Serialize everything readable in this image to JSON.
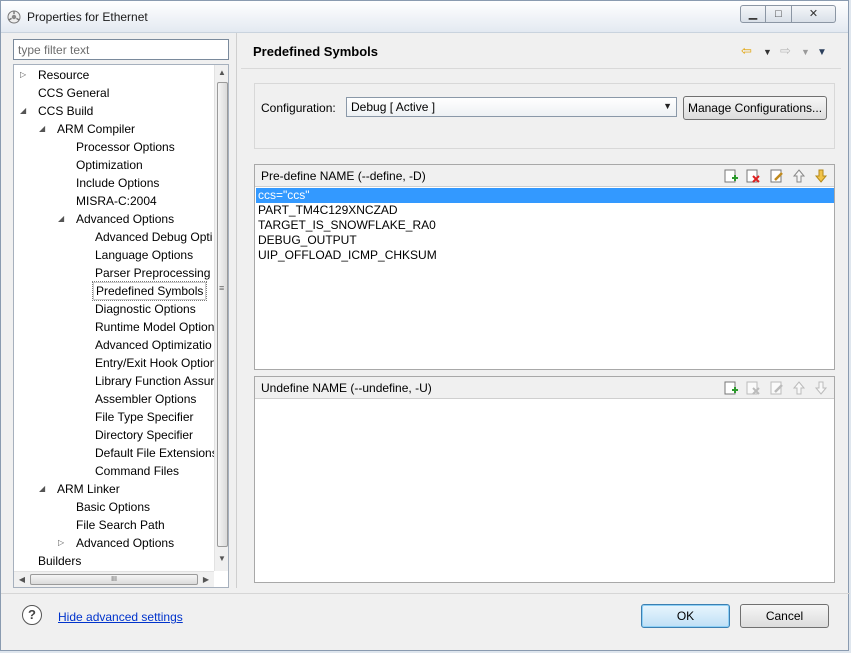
{
  "window": {
    "title": "Properties for Ethernet",
    "controls": {
      "minimize": "▁",
      "maximize": "□",
      "close": "✕"
    }
  },
  "filter": {
    "placeholder": "type filter text"
  },
  "tree": {
    "selected": "Predefined Symbols",
    "items": [
      {
        "label": "Resource",
        "level": 0,
        "expander": "collapsed"
      },
      {
        "label": "CCS General",
        "level": 0,
        "expander": "none"
      },
      {
        "label": "CCS Build",
        "level": 0,
        "expander": "expanded"
      },
      {
        "label": "ARM Compiler",
        "level": 1,
        "expander": "expanded"
      },
      {
        "label": "Processor Options",
        "level": 2,
        "expander": "none"
      },
      {
        "label": "Optimization",
        "level": 2,
        "expander": "none"
      },
      {
        "label": "Include Options",
        "level": 2,
        "expander": "none"
      },
      {
        "label": "MISRA-C:2004",
        "level": 2,
        "expander": "none"
      },
      {
        "label": "Advanced Options",
        "level": 2,
        "expander": "expanded"
      },
      {
        "label": "Advanced Debug Opti",
        "level": 3,
        "expander": "none"
      },
      {
        "label": "Language Options",
        "level": 3,
        "expander": "none"
      },
      {
        "label": "Parser Preprocessing C",
        "level": 3,
        "expander": "none"
      },
      {
        "label": "Predefined Symbols",
        "level": 3,
        "expander": "none"
      },
      {
        "label": "Diagnostic Options",
        "level": 3,
        "expander": "none"
      },
      {
        "label": "Runtime Model Option",
        "level": 3,
        "expander": "none"
      },
      {
        "label": "Advanced Optimizatio",
        "level": 3,
        "expander": "none"
      },
      {
        "label": "Entry/Exit Hook Option",
        "level": 3,
        "expander": "none"
      },
      {
        "label": "Library Function Assur",
        "level": 3,
        "expander": "none"
      },
      {
        "label": "Assembler Options",
        "level": 3,
        "expander": "none"
      },
      {
        "label": "File Type Specifier",
        "level": 3,
        "expander": "none"
      },
      {
        "label": "Directory Specifier",
        "level": 3,
        "expander": "none"
      },
      {
        "label": "Default File Extensions",
        "level": 3,
        "expander": "none"
      },
      {
        "label": "Command Files",
        "level": 3,
        "expander": "none"
      },
      {
        "label": "ARM Linker",
        "level": 1,
        "expander": "expanded"
      },
      {
        "label": "Basic Options",
        "level": 2,
        "expander": "none"
      },
      {
        "label": "File Search Path",
        "level": 2,
        "expander": "none"
      },
      {
        "label": "Advanced Options",
        "level": 2,
        "expander": "collapsed"
      },
      {
        "label": "Builders",
        "level": 0,
        "expander": "none"
      }
    ],
    "hscroll_grip": "III",
    "vscroll_grip": "≡"
  },
  "page": {
    "title": "Predefined Symbols",
    "nav": {
      "back": "⇦",
      "back_dropdown": "▼",
      "forward": "⇨",
      "forward_dropdown": "▼",
      "menu": "▼"
    }
  },
  "configuration": {
    "label": "Configuration:",
    "value": "Debug  [ Active ]",
    "manage_label": "Manage Configurations..."
  },
  "predefine": {
    "header": "Pre-define NAME (--define, -D)",
    "selected_index": 0,
    "items": [
      "ccs=\"ccs\"",
      "PART_TM4C129XNCZAD",
      "TARGET_IS_SNOWFLAKE_RA0",
      "DEBUG_OUTPUT",
      "UIP_OFFLOAD_ICMP_CHKSUM"
    ]
  },
  "undefine": {
    "header": "Undefine NAME (--undefine, -U)",
    "items": []
  },
  "toolbar_icons": [
    "add-icon",
    "delete-icon",
    "edit-icon",
    "move-up-icon",
    "move-down-icon"
  ],
  "footer": {
    "help": "?",
    "advanced_link": "Hide advanced settings",
    "ok_label": "OK",
    "cancel_label": "Cancel"
  },
  "colors": {
    "selection": "#3399ff",
    "link": "#0033cc",
    "nav_arrow": "#e0a000"
  }
}
